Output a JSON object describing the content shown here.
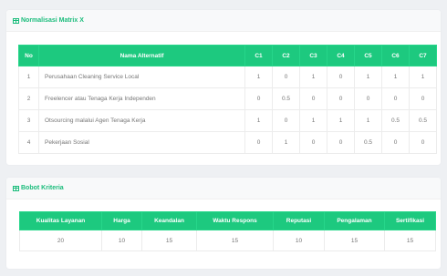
{
  "matrix_card": {
    "title": "Normalisasi Matrix X",
    "icon": "table-icon",
    "headers": [
      "No",
      "Nama Alternatif",
      "C1",
      "C2",
      "C3",
      "C4",
      "C5",
      "C6",
      "C7"
    ],
    "rows": [
      [
        "1",
        "Perusahaan Cleaning Service Local",
        "1",
        "0",
        "1",
        "0",
        "1",
        "1",
        "1"
      ],
      [
        "2",
        "Freelencer atau Tenaga Kerja Independen",
        "0",
        "0.5",
        "0",
        "0",
        "0",
        "0",
        "0"
      ],
      [
        "3",
        "Otsourcing malalui Agen Tenaga Kerja",
        "1",
        "0",
        "1",
        "1",
        "1",
        "0.5",
        "0.5"
      ],
      [
        "4",
        "Pekerjaan Sosial",
        "0",
        "1",
        "0",
        "0",
        "0.5",
        "0",
        "0"
      ]
    ]
  },
  "bobot_card": {
    "title": "Bobot Kriteria",
    "icon": "table-icon",
    "headers": [
      "Kualitas Layanan",
      "Harga",
      "Keandalan",
      "Waktu Respons",
      "Reputasi",
      "Pengalaman",
      "Sertifikasi"
    ],
    "values": [
      "20",
      "10",
      "15",
      "15",
      "10",
      "15",
      "15"
    ]
  },
  "colors": {
    "accent": "#1abc7b",
    "header_bg": "#1dc97f",
    "page_bg": "#eef0f3"
  }
}
